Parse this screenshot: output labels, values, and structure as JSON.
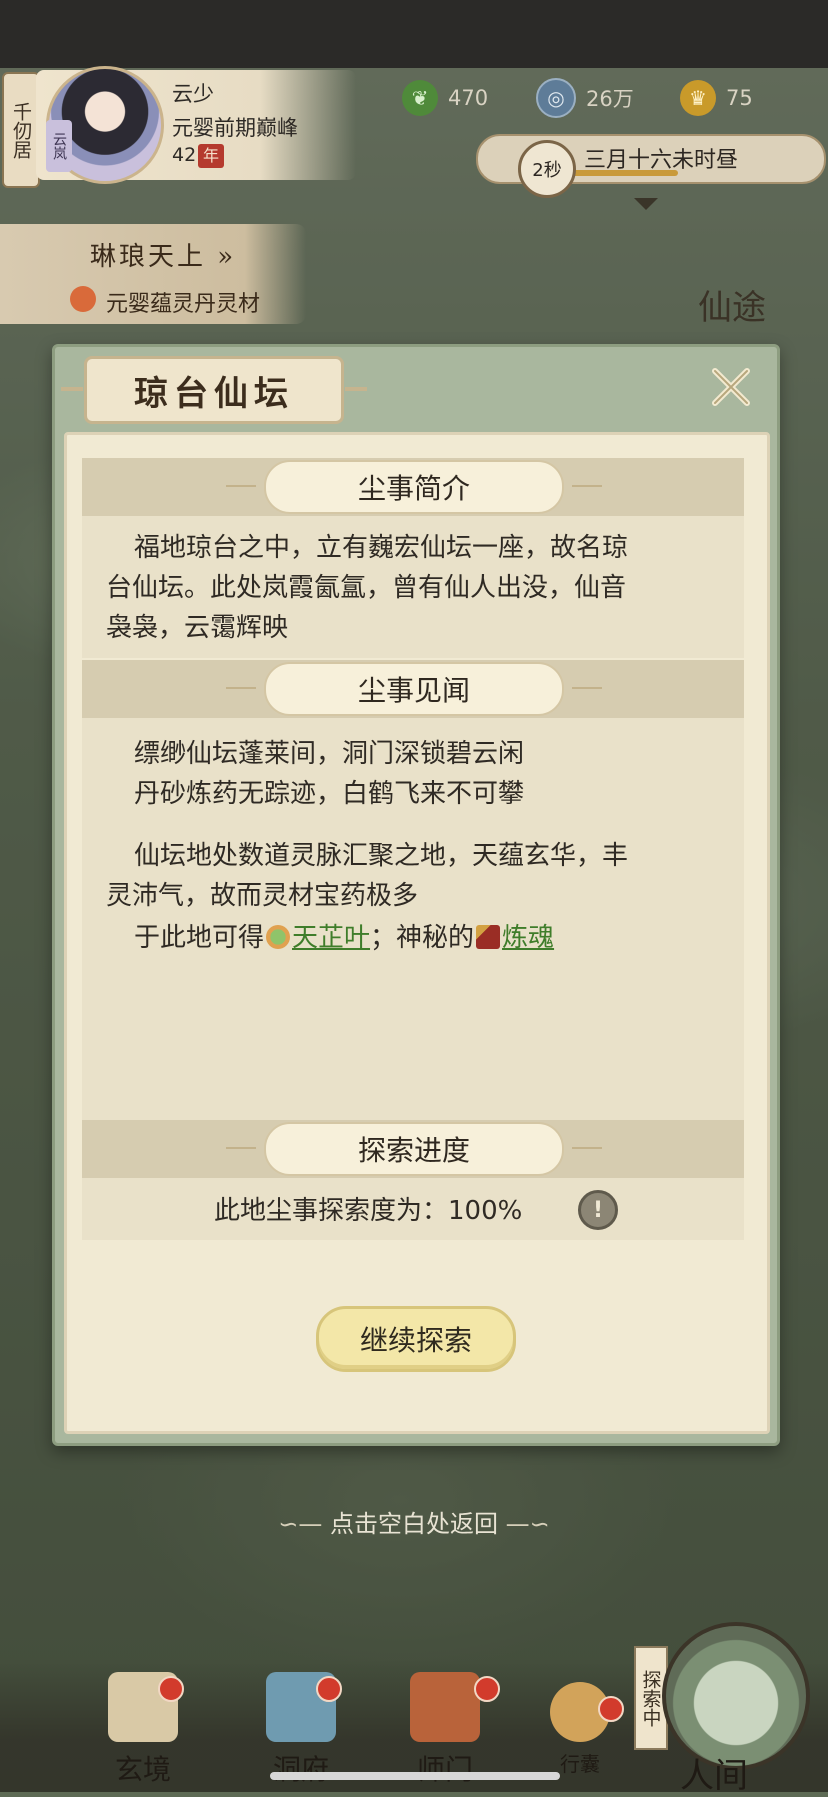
{
  "hud": {
    "location_tab": "千仞居",
    "avatar_tag": "云岚",
    "player_name": "云少",
    "realm": "元婴前期巅峰",
    "age": "42",
    "age_unit": "年",
    "resources": [
      {
        "icon": "jade-leaf-icon",
        "value": "470",
        "color": "#4f8a3a"
      },
      {
        "icon": "coin-icon",
        "value": "26万",
        "color": "#5e7c98"
      },
      {
        "icon": "gold-ingot-icon",
        "value": "75",
        "color": "#c99a2a"
      }
    ],
    "time_seconds": "2秒",
    "game_time": "三月十六未时昼"
  },
  "quest": {
    "title": "琳琅天上 »",
    "subtitle": "元婴蕴灵丹灵材"
  },
  "side_label": "仙途",
  "dialog": {
    "title": "琼台仙坛",
    "intro": {
      "heading": "尘事简介",
      "text_line1": "福地琼台之中，立有巍宏仙坛一座，故名琼",
      "text_line2": "台仙坛。此处岚霞氤氲，曾有仙人出没，仙音",
      "text_line3": "袅袅，云霭辉映"
    },
    "lore": {
      "heading": "尘事见闻",
      "poem_line1": "缥缈仙坛蓬莱间，洞门深锁碧云闲",
      "poem_line2": "丹砂炼药无踪迹，白鹤飞来不可攀",
      "desc_line1": "仙坛地处数道灵脉汇聚之地，天蕴玄华，丰",
      "desc_line2": "灵沛气，故而灵材宝药极多",
      "loot_prefix": "于此地可得",
      "loot_item1": "天芷叶",
      "loot_sep": "；神秘的",
      "loot_item2": "炼魂"
    },
    "progress": {
      "heading": "探索进度",
      "text": "此地尘事探索度为：100%"
    },
    "continue_button": "继续探索"
  },
  "hint": "点击空白处返回",
  "bottom_nav": {
    "items": [
      {
        "label": "玄境"
      },
      {
        "label": "洞府"
      },
      {
        "label": "师门"
      },
      {
        "label": "行囊"
      }
    ],
    "explore_flag": "探索中",
    "main_label": "人间"
  }
}
